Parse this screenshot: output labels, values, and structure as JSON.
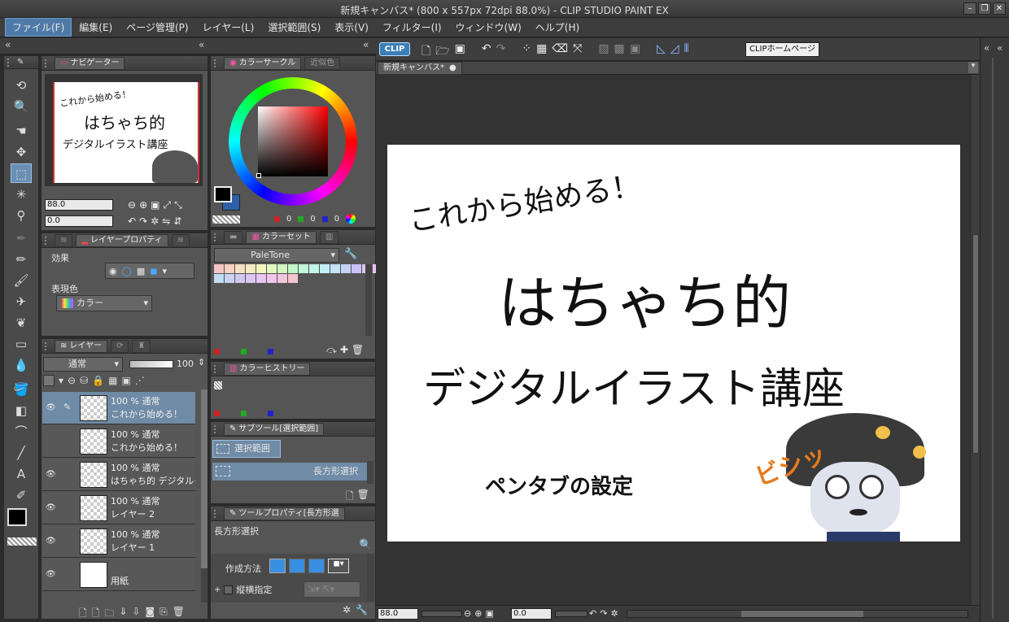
{
  "window": {
    "title": "新規キャンバス* (800 x 557px 72dpi 88.0%)  - CLIP STUDIO PAINT EX"
  },
  "menu": [
    "ファイル(F)",
    "編集(E)",
    "ページ管理(P)",
    "レイヤー(L)",
    "選択範囲(S)",
    "表示(V)",
    "フィルター(I)",
    "ウィンドウ(W)",
    "ヘルプ(H)"
  ],
  "toolbar": {
    "logo": "CLIP",
    "home_button": "CLIPホームページ"
  },
  "navigator": {
    "tab": "ナビゲーター",
    "zoom": "88.0",
    "rotation": "0.0",
    "preview": {
      "line1": "これから始める！",
      "line2": "はちゃち的",
      "line3": "デジタルイラスト講座"
    }
  },
  "layer_property": {
    "tab": "レイヤープロパティ",
    "effect_label": "効果",
    "color_label": "表現色",
    "color_value": "カラー"
  },
  "layers": {
    "tab": "レイヤー",
    "blend": "通常",
    "opacity": "100",
    "rows": [
      {
        "line1": "100 % 通常",
        "line2": "これから始める！",
        "visible": true,
        "selected": true
      },
      {
        "line1": "100 % 通常",
        "line2": "これから始める！",
        "visible": false,
        "selected": false
      },
      {
        "line1": "100 % 通常",
        "line2": "はちゃち的 デジタルイ",
        "visible": true,
        "selected": false
      },
      {
        "line1": "100 % 通常",
        "line2": "レイヤー 2",
        "visible": true,
        "selected": false
      },
      {
        "line1": "100 % 通常",
        "line2": "レイヤー 1",
        "visible": true,
        "selected": false
      },
      {
        "line1": "",
        "line2": "用紙",
        "visible": true,
        "selected": false
      }
    ]
  },
  "color_circle": {
    "tab": "カラーサークル",
    "tab2": "近似色",
    "r": "0",
    "g": "0",
    "b": "0",
    "main_color": "#000000",
    "sub_color": "#2f5fa8"
  },
  "color_set": {
    "tab": "カラーセット",
    "palette": "PaleTone",
    "swatches": [
      "#f6c6c6",
      "#f6d2c2",
      "#f6e0c2",
      "#f6ecc2",
      "#f2f6c2",
      "#e2f6c2",
      "#d2f6c2",
      "#c2f6c8",
      "#c2f6d8",
      "#c2f6e8",
      "#c2f0f6",
      "#c2e2f6",
      "#c2d2f6",
      "#c8c2f6",
      "#dcc2f6",
      "#ecc2f6",
      "#c2ddf2",
      "#c9d4f2",
      "#d2c9f2",
      "#dcc6f2",
      "#e6c6f2",
      "#f0c6ea",
      "#f2c6dc",
      "#f2c6cd"
    ]
  },
  "color_history": {
    "tab": "カラーヒストリー"
  },
  "sub_tool": {
    "tab": "サブツール[選択範囲]",
    "group": "選択範囲",
    "item": "長方形選択"
  },
  "tool_property": {
    "tab": "ツールプロパティ[長方形選",
    "tool_name": "長方形選択",
    "mode_label": "作成方法",
    "aspect_label": "縦横指定"
  },
  "canvas": {
    "tab": "新規キャンバス*",
    "zoom": "88.0",
    "rotation": "0.0",
    "text1": "これから始める！",
    "text2": "はちゃち的",
    "text3": "デジタルイラスト講座",
    "text4": "ペンタブの設定",
    "sfx": "ビシッ"
  }
}
